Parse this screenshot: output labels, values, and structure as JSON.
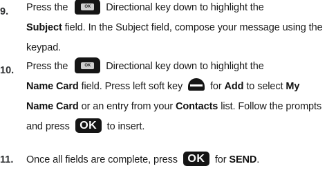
{
  "steps": [
    {
      "number": "9.",
      "text": {
        "a": "Press the",
        "b": "Directional key down to highlight the",
        "subject_bold": "Subject",
        "c": "field. In the Subject field, compose your message using the keypad."
      }
    },
    {
      "number": "10.",
      "text": {
        "a": "Press the",
        "b": "Directional key down to highlight the",
        "name_card_bold": "Name Card",
        "c": "field. Press left soft key",
        "d": "for",
        "add_bold": "Add",
        "e": "to select",
        "my_name_card_bold": "My Name Card",
        "f": "or an entry from your",
        "contacts_bold": "Contacts",
        "g": "list. Follow the prompts and press",
        "h": "to insert."
      }
    },
    {
      "number": "11.",
      "text": {
        "a": "Once all fields are complete, press",
        "b": "for",
        "send_bold": "SEND",
        "c": "."
      }
    }
  ],
  "keys": {
    "directional_center_label": "OK",
    "ok_label": "OK"
  },
  "icons": {
    "directional_key": "directional-ok-key-icon",
    "ok_key": "ok-key-icon",
    "left_soft_key": "left-soft-key-icon"
  }
}
